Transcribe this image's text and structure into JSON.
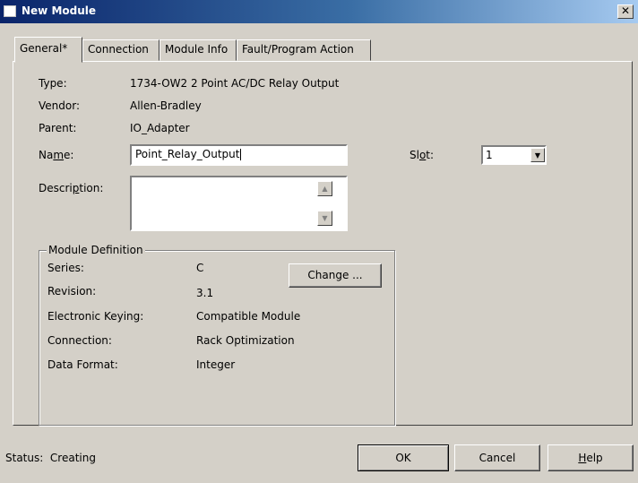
{
  "window": {
    "title": "New Module",
    "close_glyph": "✕"
  },
  "tabs": [
    {
      "label": "General*"
    },
    {
      "label": "Connection"
    },
    {
      "label": "Module Info"
    },
    {
      "label": "Fault/Program Action"
    }
  ],
  "general": {
    "type_label": "Type:",
    "type_value": "1734-OW2 2 Point AC/DC Relay Output",
    "vendor_label": "Vendor:",
    "vendor_value": "Allen-Bradley",
    "parent_label": "Parent:",
    "parent_value": "IO_Adapter",
    "name_label_pre": "Na",
    "name_label_mnemonic": "m",
    "name_label_post": "e:",
    "name_value": "Point_Relay_Output",
    "description_label_pre": "Descri",
    "description_label_mnemonic": "p",
    "description_label_post": "tion:",
    "description_value": "",
    "slot_label_pre": "Sl",
    "slot_label_mnemonic": "o",
    "slot_label_post": "t:",
    "slot_value": "1"
  },
  "module_definition": {
    "title": "Module Definition",
    "series_label": "Series:",
    "series_value": "C",
    "revision_label": "Revision:",
    "revision_value": "3.1",
    "keying_label": "Electronic Keying:",
    "keying_value": "Compatible Module",
    "connection_label": "Connection:",
    "connection_value": "Rack Optimization",
    "data_format_label": "Data Format:",
    "data_format_value": "Integer",
    "change_button": "Change ..."
  },
  "footer": {
    "status_label": "Status:",
    "status_value": "Creating",
    "ok_button": "OK",
    "cancel_button": "Cancel",
    "help_button_mnemonic": "H",
    "help_button_post": "elp"
  },
  "colors": {
    "titlebar_start": "#0a246a",
    "titlebar_end": "#a6caf0",
    "dialog_face": "#d4d0c8"
  }
}
